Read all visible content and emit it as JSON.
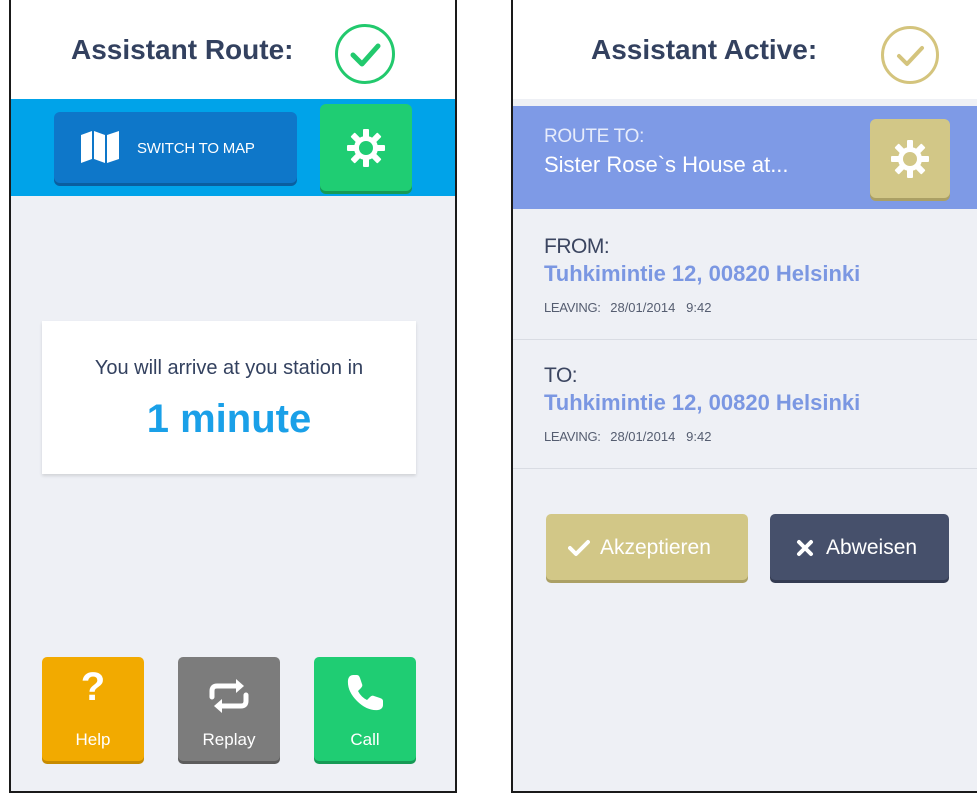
{
  "left_screen": {
    "title": "Assistant Route:",
    "status_icon": "check-circle-icon",
    "switch_button": {
      "label": "SWITCH TO MAP",
      "icon": "map-icon"
    },
    "settings_icon": "gear-icon",
    "info": {
      "message": "You will arrive at you station in",
      "time": "1 minute"
    },
    "actions": [
      {
        "label": "Help",
        "icon": "question-icon"
      },
      {
        "label": "Replay",
        "icon": "repeat-icon"
      },
      {
        "label": "Call",
        "icon": "phone-icon"
      }
    ],
    "colors": {
      "accent": "#00a3e9",
      "green": "#1fcd73",
      "help": "#f2aa00",
      "replay": "#7c7c7c"
    }
  },
  "right_screen": {
    "title": "Assistant Active:",
    "status_icon": "check-circle-icon",
    "route": {
      "label": "ROUTE TO:",
      "destination": "Sister Rose`s House at..."
    },
    "settings_icon": "gear-icon",
    "from": {
      "label": "FROM:",
      "address": "Tuhkimintie 12,  00820 Helsinki",
      "leaving_label": "LEAVING:",
      "leaving_value": "28/01/2014   9:42"
    },
    "to": {
      "label": "TO:",
      "address": "Tuhkimintie 12,  00820 Helsinki",
      "leaving_label": "LEAVING:",
      "leaving_value": "28/01/2014   9:42"
    },
    "accept_button": "Akzeptieren",
    "reject_button": "Abweisen",
    "colors": {
      "route_bar": "#7e9ae6",
      "gold": "#d2c787",
      "dark": "#46506b"
    }
  }
}
